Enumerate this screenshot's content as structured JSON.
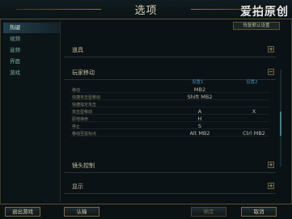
{
  "window": {
    "title": "选项",
    "watermark": "爱拍原创"
  },
  "sidebar": {
    "items": [
      {
        "label": "热键",
        "active": true
      },
      {
        "label": "视频"
      },
      {
        "label": "音频"
      },
      {
        "label": "界面"
      },
      {
        "label": "游戏"
      }
    ]
  },
  "toolbar": {
    "restore_default": "恢复默认设置"
  },
  "sections": {
    "items": {
      "title": "道具",
      "toggle": "+"
    },
    "player_move": {
      "title": "玩家移动",
      "toggle": "−"
    },
    "camera": {
      "title": "镜头控制",
      "toggle": "+"
    },
    "display": {
      "title": "显示",
      "toggle": "+"
    }
  },
  "columns": {
    "col1": "设置1",
    "col2": "设置2"
  },
  "bindings": [
    {
      "label": "移动",
      "v1": "MB2",
      "v2": ""
    },
    {
      "label": "快捷攻击型移动",
      "v1": "Shift  MB2",
      "v2": ""
    },
    {
      "label": "快捷指定攻击",
      "v1": "",
      "v2": ""
    },
    {
      "label": "攻击型移动",
      "v1": "A",
      "v2": "X"
    },
    {
      "label": "原地待命",
      "v1": "H",
      "v2": ""
    },
    {
      "label": "停止",
      "v1": "S",
      "v2": ""
    },
    {
      "label": "移动至鼠标点",
      "v1": "Alt  MB2",
      "v2": "Ctrl  MB2"
    }
  ],
  "bottom": {
    "exit_game": "退出游戏",
    "confirm": "认输",
    "ok": "确定",
    "cancel": "取消"
  }
}
